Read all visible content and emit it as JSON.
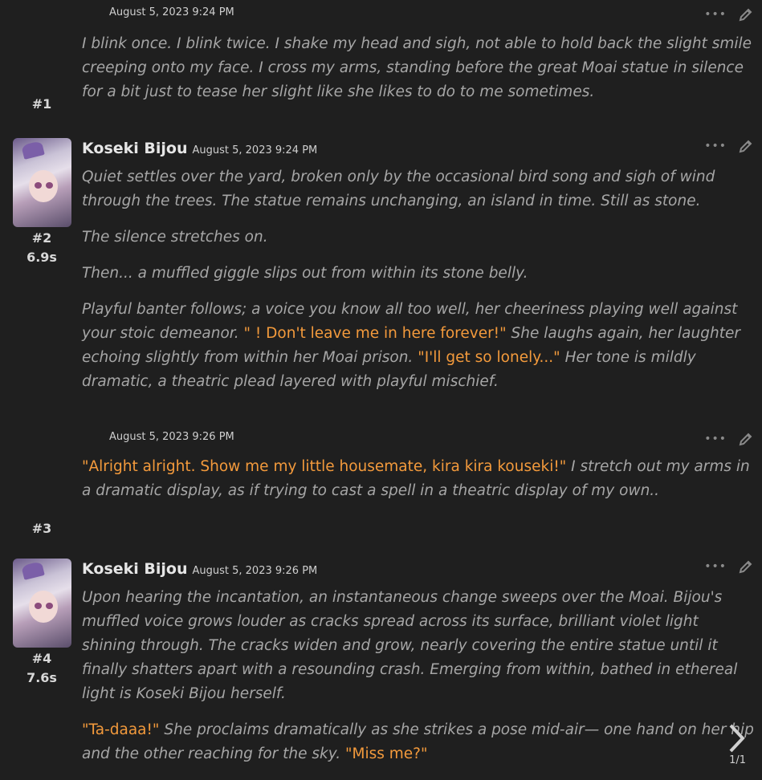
{
  "messages": [
    {
      "index": "#1",
      "timer": "",
      "name": "",
      "time": "August 5, 2023 9:24 PM",
      "paragraphs": [
        [
          "I blink once. I blink twice. I shake my head and sigh, not able to hold back the slight smile creeping onto my face. I cross my arms, standing before the great Moai statue in silence for a bit just to tease her slight like she likes to do to me sometimes."
        ]
      ]
    },
    {
      "index": "#2",
      "timer": "6.9s",
      "name": "Koseki Bijou",
      "time": "August 5, 2023 9:24 PM",
      "paragraphs": [
        [
          "Quiet settles over the yard, broken only by the occasional bird song and sigh of wind through the trees. The statue remains unchanging, an island in time. Still as stone."
        ],
        [
          "The silence stretches on."
        ],
        [
          "Then... a muffled giggle slips out from within its stone belly."
        ],
        [
          "Playful banter follows; a voice you know all too well, her cheeriness playing well against your stoic demeanor. ",
          "\"     ! Don't leave me in here forever!\"",
          " She laughs again, her laughter echoing slightly from within her Moai prison. ",
          "\"I'll get so lonely...\"",
          " Her tone is mildly dramatic, a theatric plead layered with playful mischief."
        ]
      ]
    },
    {
      "index": "#3",
      "timer": "",
      "name": "",
      "time": "August 5, 2023 9:26 PM",
      "paragraphs": [
        [
          "",
          "\"Alright alright. Show me my little housemate, kira kira kouseki!\"",
          " I stretch out my arms in a dramatic display, as if trying to cast a spell in a theatric display of my own.."
        ]
      ]
    },
    {
      "index": "#4",
      "timer": "7.6s",
      "name": "Koseki Bijou",
      "time": "August 5, 2023 9:26 PM",
      "paragraphs": [
        [
          "Upon hearing the incantation, an instantaneous change sweeps over the Moai. Bijou's muffled voice grows louder as cracks spread across its surface, brilliant violet light shining through. The cracks widen and grow, nearly covering the entire statue until it finally shatters apart with a resounding crash. Emerging from within, bathed in ethereal light is Koseki Bijou herself."
        ],
        [
          "",
          "\"Ta-daaa!\"",
          " She proclaims dramatically as she strikes a pose mid-air— one hand on her hip and the other reaching for the sky. ",
          "\"Miss me?\""
        ]
      ]
    }
  ],
  "pager": {
    "label": "1/1"
  },
  "icons": {
    "more": "more-dots-icon",
    "edit": "pencil-icon",
    "next": "chevron-right-icon"
  },
  "colors": {
    "quote": "#f39a3c",
    "background": "#1f1f1f"
  }
}
